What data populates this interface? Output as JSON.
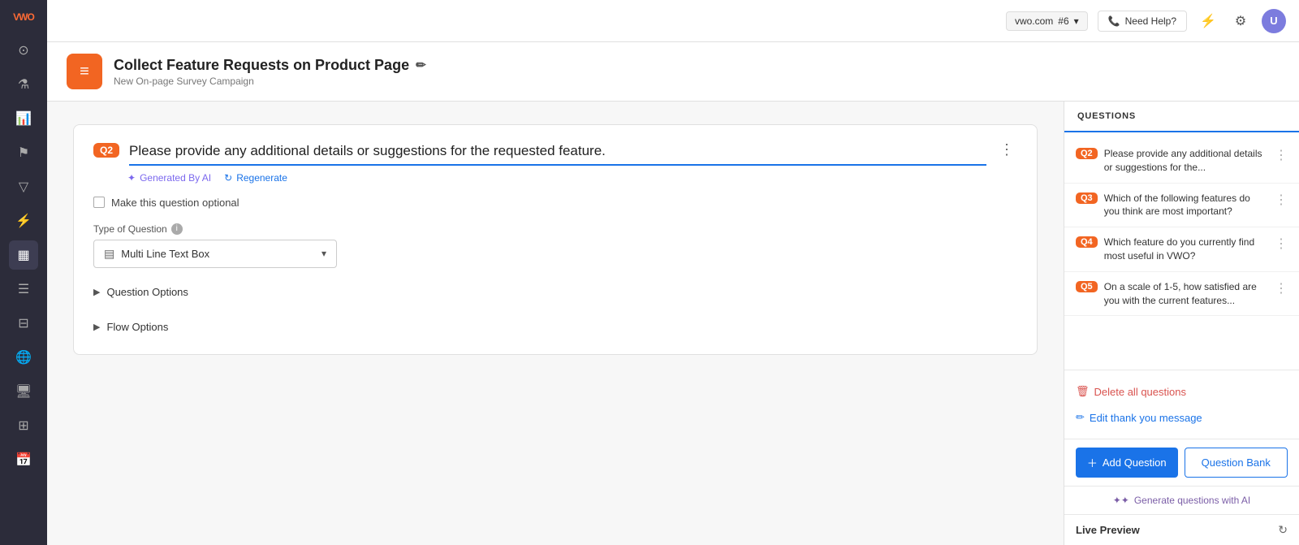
{
  "app": {
    "logo": "VWO",
    "domain": "vwo.com",
    "domain_num": "#6",
    "need_help": "Need Help?",
    "avatar_initials": "U"
  },
  "campaign": {
    "title": "Collect Feature Requests on Product Page",
    "subtitle": "New On-page Survey Campaign",
    "icon": "≡"
  },
  "questions_panel": {
    "header": "QUESTIONS",
    "items": [
      {
        "badge": "Q2",
        "text": "Please provide any additional details or suggestions for the...",
        "badge_style": "orange"
      },
      {
        "badge": "Q3",
        "text": "Which of the following features do you think are most important?",
        "badge_style": "orange"
      },
      {
        "badge": "Q4",
        "text": "Which feature do you currently find most useful in VWO?",
        "badge_style": "orange"
      },
      {
        "badge": "Q5",
        "text": "On a scale of 1-5, how satisfied are you with the current features...",
        "badge_style": "orange"
      }
    ],
    "delete_all": "Delete all questions",
    "edit_thank_you": "Edit thank you message",
    "add_question": "Add Question",
    "question_bank": "Question Bank",
    "generate_ai": "Generate questions with AI",
    "live_preview": "Live Preview"
  },
  "editor": {
    "question_badge": "Q2",
    "question_text": "Please provide any additional details or suggestions for the requested feature.",
    "generated_by_ai": "Generated By AI",
    "regenerate": "Regenerate",
    "optional_label": "Make this question optional",
    "type_label": "Type of Question",
    "type_info": "i",
    "type_value": "Multi Line Text Box",
    "question_options": "Question Options",
    "flow_options": "Flow Options"
  },
  "sidebar": {
    "icons": [
      "dashboard",
      "flask",
      "chart",
      "flag",
      "filter",
      "lightning",
      "grid",
      "calendar",
      "person",
      "globe",
      "monitor",
      "layers",
      "calendar2"
    ]
  }
}
